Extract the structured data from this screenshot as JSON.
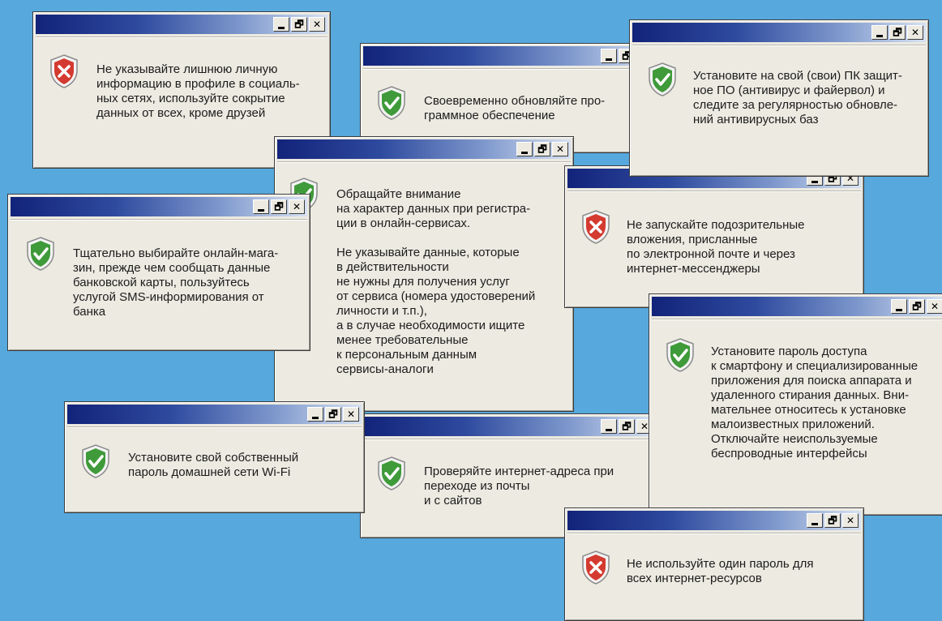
{
  "colors": {
    "desktop": "#57a8dc",
    "window": "#eceae1",
    "titlebar_start": "#12237a",
    "titlebar_end": "#d6e1f2",
    "warn": "#d43a2f",
    "ok": "#3f9a3a"
  },
  "controls": {
    "minimize_icon": "minimize-icon",
    "restore_icon": "restore-icon",
    "close_icon": "close-icon",
    "restore_glyph": "🗗",
    "close_glyph": "✕"
  },
  "windows": [
    {
      "id": "w1",
      "icon": "warning-shield-icon",
      "text": "Не указывайте лишнюю личную\nинформацию в профиле в социаль-\nных сетях, используйте сокрытие\nданных от всех, кроме друзей"
    },
    {
      "id": "w2",
      "icon": "ok-shield-icon",
      "text": "Своевременно обновляйте про-\nграммное обеспечение"
    },
    {
      "id": "w3",
      "icon": "ok-shield-icon",
      "text": "Установите на свой (свои) ПК защит-\nное ПО (антивирус и файервол) и\nследите за регулярностью обновле-\nний антивирусных баз"
    },
    {
      "id": "w4",
      "icon": "ok-shield-icon",
      "text": "Обращайте внимание\nна характер данных при регистра-\nции в онлайн-сервисах.\n\nНе указывайте данные, которые\nв действительности\nне нужны для получения услуг\nот сервиса (номера удостоверений\nличности и т.п.),\nа в случае необходимости ищите\nменее требовательные\nк персональным данным\nсервисы-аналоги"
    },
    {
      "id": "w5",
      "icon": "warning-shield-icon",
      "text": "Не запускайте подозрительные\nвложения, присланные\nпо электронной почте и через\nинтернет-мессенджеры"
    },
    {
      "id": "w6",
      "icon": "ok-shield-icon",
      "text": "Тщательно выбирайте онлайн-мага-\nзин, прежде чем сообщать данные\nбанковской карты, пользуйтесь\nуслугой SMS-информирования от\nбанка"
    },
    {
      "id": "w7",
      "icon": "ok-shield-icon",
      "text": "Установите пароль доступа\nк смартфону и специализированные\nприложения для поиска аппарата и\nудаленного стирания данных. Вни-\nмательнее относитесь к установке\nмалоизвестных приложений.\nОтключайте неиспользуемые\nбеспроводные интерфейсы"
    },
    {
      "id": "w8",
      "icon": "ok-shield-icon",
      "text": "Установите свой собственный\nпароль домашней сети Wi-Fi"
    },
    {
      "id": "w9",
      "icon": "ok-shield-icon",
      "text": "Проверяйте интернет-адреса при\nпереходе из почты\nи с сайтов"
    },
    {
      "id": "w10",
      "icon": "warning-shield-icon",
      "text": "Не используйте один пароль для\nвсех интернет-ресурсов"
    }
  ]
}
